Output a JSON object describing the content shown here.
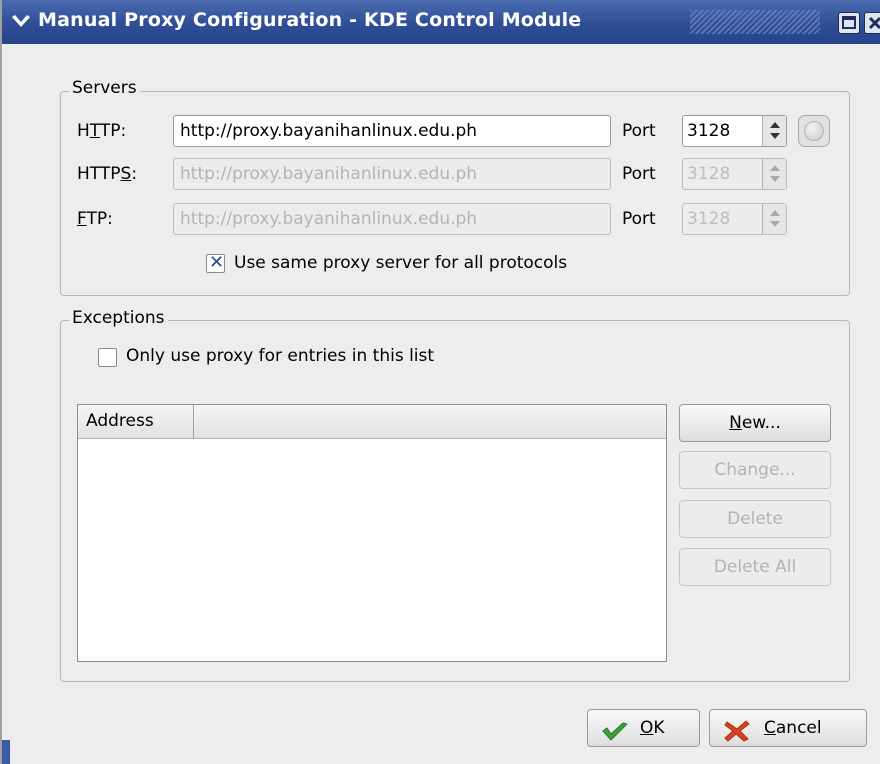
{
  "window": {
    "title": "Manual Proxy Configuration - KDE Control Module"
  },
  "servers": {
    "legend": "Servers",
    "http": {
      "label_pre": "H",
      "label_u": "T",
      "label_post": "TP:",
      "value": "http://proxy.bayanihanlinux.edu.ph",
      "port_label": "Port",
      "port": "3128"
    },
    "https": {
      "label_pre": "HTTP",
      "label_u": "S",
      "label_post": ":",
      "value": "http://proxy.bayanihanlinux.edu.ph",
      "port_label": "Port",
      "port": "3128"
    },
    "ftp": {
      "label_pre": "",
      "label_u": "F",
      "label_post": "TP:",
      "value": "http://proxy.bayanihanlinux.edu.ph",
      "port_label": "Port",
      "port": "3128"
    },
    "same_proxy": {
      "label": "Use same proxy server for all protocols",
      "checked": true
    }
  },
  "exceptions": {
    "legend": "Exceptions",
    "only_use": {
      "label": "Only use proxy for entries in this list",
      "checked": false
    },
    "list": {
      "column_address": "Address",
      "rows": []
    },
    "buttons": {
      "new": {
        "pre": "",
        "u": "N",
        "post": "ew..."
      },
      "change": {
        "label": "Change..."
      },
      "delete": {
        "label": "Delete"
      },
      "delete_all": {
        "label": "Delete All"
      }
    }
  },
  "footer": {
    "ok": {
      "u": "O",
      "post": "K"
    },
    "cancel": {
      "u": "C",
      "post": "ancel"
    }
  },
  "colors": {
    "titlebar": "#2f4e96",
    "ok_check": "#3aa03a",
    "cancel_x": "#d8421e"
  }
}
